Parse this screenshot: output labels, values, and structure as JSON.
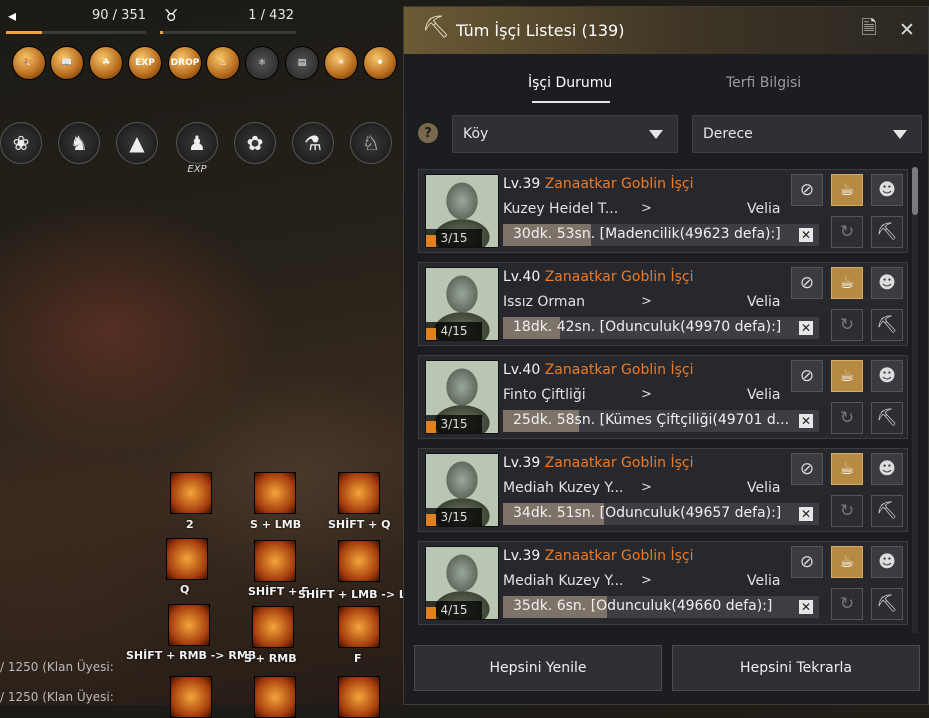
{
  "hud": {
    "energy": "90 / 351",
    "contribution": "1 / 432",
    "energy_progress": 0.26,
    "contribution_progress": 0.02,
    "buffs": [
      "palette-icon",
      "book-icon",
      "tree-icon",
      "EXP",
      "DROP",
      "cake-icon",
      "molecule-icon",
      "scroll-icon",
      "sun-icon",
      "mushroom-icon"
    ],
    "skill_icons": [
      "paw-icon",
      "horse-head-icon",
      "tent-icon",
      "group-exp-icon",
      "butterfly-icon",
      "potion-icon",
      "horse-icon"
    ],
    "exp_label": "EXP"
  },
  "quickslots": [
    {
      "key": "2"
    },
    {
      "key": "S + LMB"
    },
    {
      "key": "SHİFT + Q"
    },
    {
      "key": "Q"
    },
    {
      "key": "SHİFT + F"
    },
    {
      "key": "SHİFT + LMB -> LM"
    },
    {
      "key": "SHİFT + RMB -> RMB"
    },
    {
      "key": "S + RMB"
    },
    {
      "key": "F"
    }
  ],
  "chat": [
    "/ 1250 (Klan Üyesi:",
    "/ 1250 (Klan Üyesi:"
  ],
  "panel": {
    "title": "Tüm İşçi Listesi (139)",
    "tabs": [
      "İşçi Durumu",
      "Terfi Bilgisi"
    ],
    "filter_town": "Köy",
    "filter_grade": "Derece",
    "help": "?",
    "workers": [
      {
        "level": "Lv.39",
        "name": "Zanaatkar Goblin İşçi",
        "location": "Kuzey Heidel T...",
        "town": "Velia",
        "stamina": "3/15",
        "minutes": "30dk.",
        "seconds": " 53sn.",
        "job": " [Madencilik(49623 defa):]",
        "progress": 0.28
      },
      {
        "level": "Lv.40",
        "name": "Zanaatkar Goblin İşçi",
        "location": "Issız Orman",
        "town": "Velia",
        "stamina": "4/15",
        "minutes": "18dk.",
        "seconds": " 42sn.",
        "job": " [Odunculuk(49970 defa):]",
        "progress": 0.18
      },
      {
        "level": "Lv.40",
        "name": "Zanaatkar Goblin İşçi",
        "location": "Finto Çiftliği",
        "town": "Velia",
        "stamina": "3/15",
        "minutes": "25dk.",
        "seconds": " 58sn.",
        "job": " [Kümes Çiftçiliği(49701 d...",
        "progress": 0.24
      },
      {
        "level": "Lv.39",
        "name": "Zanaatkar Goblin İşçi",
        "location": "Mediah Kuzey Y...",
        "town": "Velia",
        "stamina": "3/15",
        "minutes": "34dk.",
        "seconds": " 51sn.",
        "job": " [Odunculuk(49657 defa):]",
        "progress": 0.32
      },
      {
        "level": "Lv.39",
        "name": "Zanaatkar Goblin İşçi",
        "location": "Mediah Kuzey Y...",
        "town": "Velia",
        "stamina": "4/15",
        "minutes": "35dk.",
        "seconds": " 6sn.",
        "job": " [Odunculuk(49660 defa):]",
        "progress": 0.33
      }
    ],
    "arrow": ">",
    "btn_refresh_all": "Hepsini Yenile",
    "btn_repeat_all": "Hepsini Tekrarla",
    "accent": "#ef7a23"
  }
}
